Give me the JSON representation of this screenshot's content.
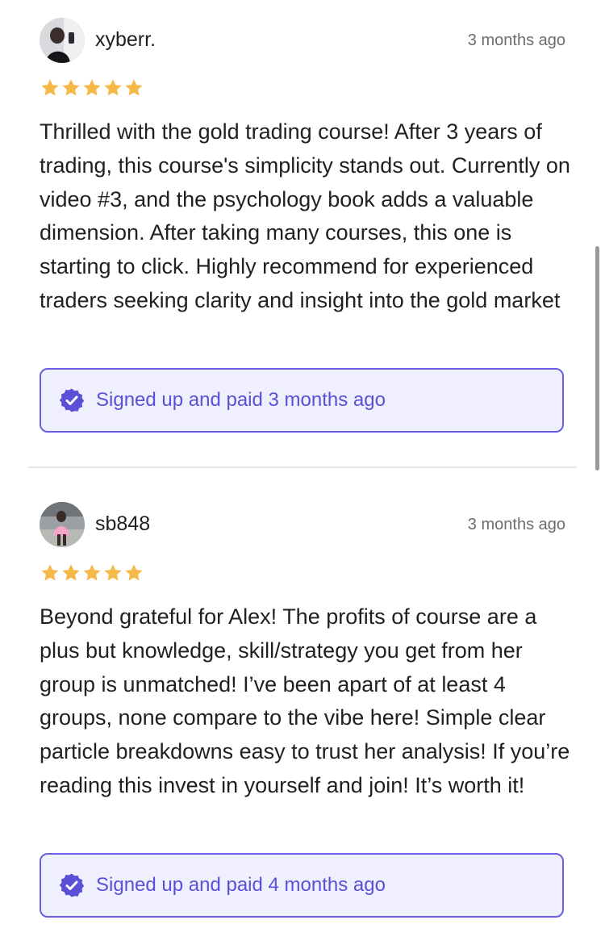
{
  "reviews": [
    {
      "username": "xyberr.",
      "timestamp": "3 months ago",
      "rating": 5,
      "text": "Thrilled with the gold trading course! After 3 years of trading, this course's simplicity stands out. Currently on video #3, and the psychology book adds a valuable dimension. After taking many courses, this one is starting to click. Highly recommend for experienced traders seeking clarity and insight into the gold market",
      "verified": "Signed up and paid 3 months ago"
    },
    {
      "username": "sb848",
      "timestamp": "3 months ago",
      "rating": 5,
      "text": "Beyond grateful for Alex! The profits of course are a plus but knowledge, skill/strategy you get from her group is unmatched! I’ve been apart of at least 4 groups, none compare to the vibe here! Simple clear particle breakdowns easy to trust her analysis! If you’re reading this invest in yourself and join! It’s worth it!",
      "verified": "Signed up and paid 4 months ago"
    }
  ],
  "icons": {
    "star": "star-icon",
    "verified": "verified-badge-icon"
  },
  "colors": {
    "star": "#f5b94a",
    "accent": "#5a4fd6",
    "badge_bg": "#efeffd",
    "badge_border": "#6a5fe0"
  }
}
